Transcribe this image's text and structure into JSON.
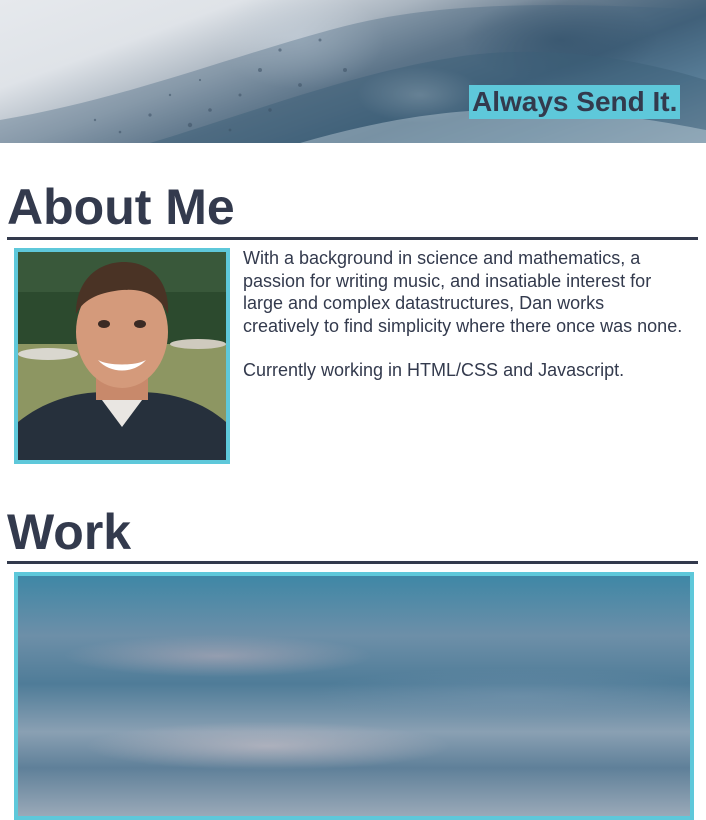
{
  "hero": {
    "tagline": "Always Send It."
  },
  "about": {
    "heading": "About Me",
    "photo_alt": "Portrait of Dan",
    "paragraphs": [
      "With a background in science and mathematics, a passion for writing music, and insatiable interest for large and complex datastructures, Dan works creatively to find simplicity where there once was none.",
      "Currently working in HTML/CSS and Javascript."
    ]
  },
  "work": {
    "heading": "Work"
  },
  "colors": {
    "accent": "#5ec8da",
    "text": "#333a4d",
    "background": "#ffffff"
  }
}
